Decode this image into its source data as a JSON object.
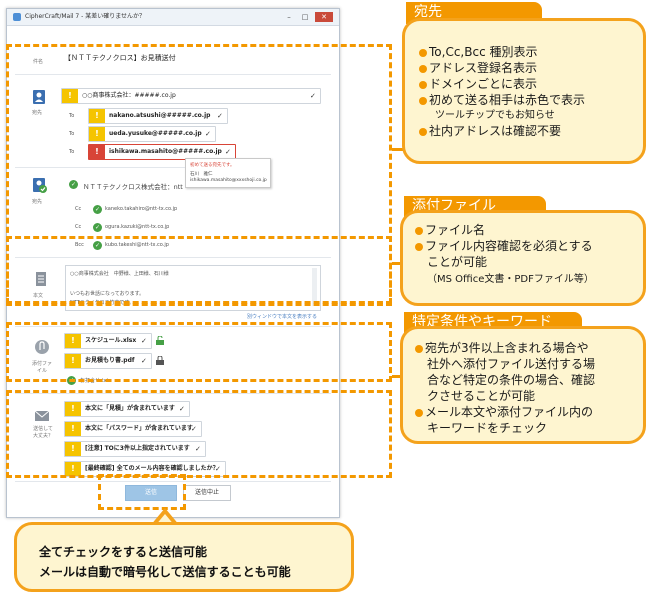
{
  "window": {
    "title": "CipherCraft/Mail 7 - 某差い確りませんか？"
  },
  "subject": {
    "label": "件名",
    "value": "【ＮＴＴテクノクロス】お見積送付"
  },
  "recipients": {
    "section_label": "宛先",
    "company": "○○商事株式会社：#####.co.jp",
    "rows": [
      {
        "field": "To",
        "address": "nakano.atsushi@#####.co.jp"
      },
      {
        "field": "To",
        "address": "ueda.yusuke@#####.co.jp"
      },
      {
        "field": "To",
        "address": "ishikawa.masahito@#####.co.jp"
      }
    ],
    "tooltip": {
      "line1": "初めて送る宛先です。",
      "line2": "石川　雅仁",
      "line3": "ishikawa.masahito@xxxshoji.co.jp"
    }
  },
  "internal": {
    "section_label": "宛先",
    "company": "ＮＴＴテクノクロス株式会社：ntt",
    "rows": [
      {
        "field": "Cc",
        "address": "kaneko.takahiro@ntt-tx.co.jp"
      },
      {
        "field": "Cc",
        "address": "ogura.kazuki@ntt-tx.co.jp"
      },
      {
        "field": "Bcc",
        "address": "kubo.takeshi@ntt-tx.co.jp"
      }
    ]
  },
  "body": {
    "section_label": "本文",
    "lines": [
      "○○商事株式会社　中野様、上田様、石川様",
      "",
      "いつもお世話になっております。",
      "NTTテクノクロス竹本です。"
    ],
    "link": "別ウィンドウで本文を表示する"
  },
  "attachments": {
    "section_label": "添付ファイル",
    "files": [
      {
        "name": "スケジュール.xlsx"
      },
      {
        "name": "お見積もり書.pdf"
      }
    ],
    "total": "お打合せ.txt"
  },
  "checks": {
    "section_label": "送信して大丈夫？",
    "items": [
      "本文に「見積」が含まれています",
      "本文に「パスワード」が含まれています",
      "[注意] TOに3件以上指定されています",
      "[最終確認] 全てのメール内容を確認しましたか？"
    ]
  },
  "buttons": {
    "send": "送信",
    "cancel": "送信中止"
  },
  "callouts": {
    "dest": {
      "header": "宛先",
      "items": [
        "To,Cc,Bcc 種別表示",
        "アドレス登録名表示",
        "ドメインごとに表示",
        "初めて送る相手は赤色で表示"
      ],
      "sub": "ツールチップでもお知らせ",
      "last": "社内アドレスは確認不要"
    },
    "attach": {
      "header": "添付ファイル",
      "items": [
        "ファイル名",
        "ファイル内容確認を必須とする"
      ],
      "cont": "ことが可能",
      "sub": "（MS Office文書・PDFファイル等）"
    },
    "cond": {
      "header": "特定条件やキーワード",
      "lines": [
        "宛先が3件以上含まれる場合や",
        "社外へ添付ファイル送付する場",
        "合など特定の条件の場合、確認",
        "クさせることが可能",
        "メール本文や添付ファイル内の",
        "キーワードをチェック"
      ]
    },
    "bottom": {
      "line1": "全てチェックをすると送信可能",
      "line2": "メールは自動で暗号化して送信することも可能"
    }
  },
  "colors": {
    "accent": "#f39800",
    "callout_bg": "#fef5d0",
    "warning": "#f5c400",
    "error": "#d84437"
  }
}
